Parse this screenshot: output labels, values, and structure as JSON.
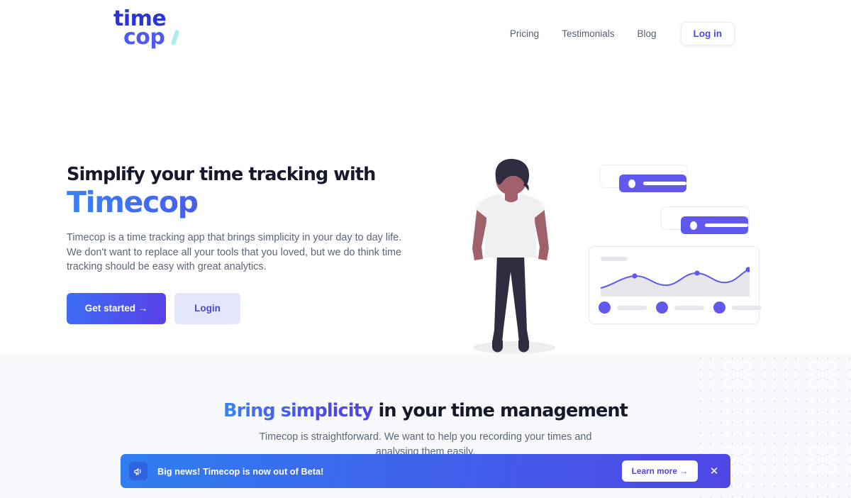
{
  "header": {
    "logo": {
      "line1": "time",
      "line2": "cop",
      "accent_color": "#a8f0ec"
    },
    "nav": [
      {
        "label": "Pricing"
      },
      {
        "label": "Testimonials"
      },
      {
        "label": "Blog"
      }
    ],
    "login_label": "Log in"
  },
  "hero": {
    "heading_line1": "Simplify your time tracking with",
    "heading_line2": "Timecop",
    "paragraph": "Timecop is a time tracking app that brings simplicity in your day to day life. We don't want to replace all your tools that you loved, but we do think time tracking should be easy with great analytics.",
    "primary_button": "Get started →",
    "secondary_button": "Login"
  },
  "illustration": {
    "person_alt": "standing-person",
    "card1_icon": "toggle-dot",
    "card2_icon": "toggle-dot",
    "analytics_card_alt": "analytics-chart-card"
  },
  "section2": {
    "heading_highlight": "Bring simplicity",
    "heading_rest": " in your time management",
    "paragraph": "Timecop is straightforward. We want to help you recording your times and analysing them easily."
  },
  "banner": {
    "icon": "megaphone-icon",
    "message": "Big news! Timecop is now out of Beta!",
    "cta_label": "Learn more →",
    "close_label": "✕"
  },
  "colors": {
    "brand_blue": "#4f46e5",
    "brand_light_blue": "#3b82f6",
    "purple": "#6158ee",
    "dark_text": "#15192b",
    "muted_text": "#5c6577",
    "section_bg": "#f7f9fc"
  },
  "chart_data": {
    "type": "area",
    "title": "",
    "x": [
      0,
      1,
      2,
      3,
      4,
      5,
      6,
      7,
      8
    ],
    "values": [
      18,
      30,
      36,
      26,
      22,
      38,
      30,
      24,
      44
    ],
    "ylim": [
      0,
      50
    ],
    "marker_points": [
      {
        "x": 2,
        "y": 36
      },
      {
        "x": 5,
        "y": 38
      },
      {
        "x": 8,
        "y": 44
      }
    ],
    "line_color": "#6158ee",
    "fill_color": "#e7e7eb",
    "xlabel": "",
    "ylabel": "",
    "grid": false,
    "legend": false
  }
}
